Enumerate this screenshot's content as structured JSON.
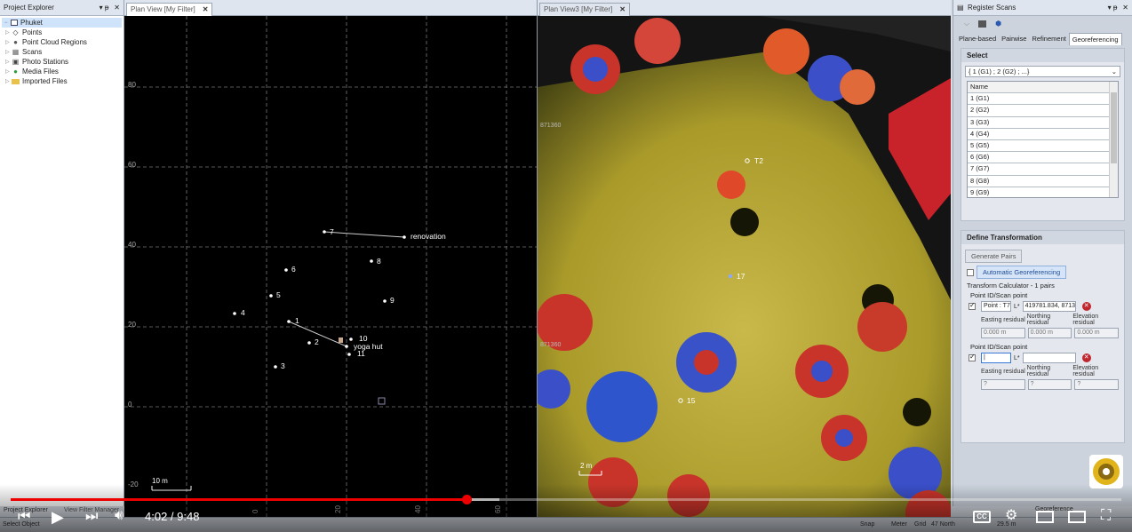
{
  "project_explorer": {
    "title": "Project Explorer",
    "ctl_pin": "▾ ᵽ",
    "ctl_close": "✕",
    "items": [
      {
        "label": "Phuket"
      },
      {
        "label": "Points"
      },
      {
        "label": "Point Cloud Regions"
      },
      {
        "label": "Scans"
      },
      {
        "label": "Photo Stations"
      },
      {
        "label": "Media Files"
      },
      {
        "label": "Imported Files"
      }
    ]
  },
  "view1": {
    "tab_label": "Plan View [My Filter]",
    "y_ticks": [
      "80",
      "60",
      "40",
      "20",
      "0",
      "-20"
    ],
    "x_ticks": [
      "0",
      "20",
      "40",
      "60"
    ],
    "scale_label": "10 m",
    "points": [
      {
        "label": "7"
      },
      {
        "label": "renovation"
      },
      {
        "label": "6"
      },
      {
        "label": "8"
      },
      {
        "label": "5"
      },
      {
        "label": "9"
      },
      {
        "label": "4"
      },
      {
        "label": "1"
      },
      {
        "label": "2"
      },
      {
        "label": "10"
      },
      {
        "label": "yoga hut"
      },
      {
        "label": "11"
      },
      {
        "label": "3"
      }
    ]
  },
  "view2": {
    "tab_label": "Plan View3 [My Filter]",
    "point_labels": [
      "T2",
      "17",
      "15"
    ],
    "coord_labels": [
      "871360",
      "871360"
    ],
    "scale_label": "2 m"
  },
  "register_scans": {
    "title": "Register Scans",
    "ctl_pin": "▾ ᵽ",
    "ctl_close": "✕",
    "tabs": [
      "Plane-based",
      "Pairwise",
      "Refinement",
      "Georeferencing"
    ],
    "select_header": "Select",
    "combo_value": "{ 1 (G1) ; 2 (G2) ; ...}",
    "list_header": "Name",
    "list_items": [
      "1 (G1)",
      "2 (G2)",
      "3 (G3)",
      "4 (G4)",
      "5 (G5)",
      "6 (G6)",
      "7 (G7)",
      "8 (G8)",
      "9 (G9)"
    ],
    "define_header": "Define Transformation",
    "generate_pairs": "Generate Pairs",
    "auto_georef": "Automatic Georeferencing",
    "calc_label": "Transform Calculator - 1 pairs",
    "pair1": {
      "label": "Point ID/Scan point",
      "point_id": "Point : T7",
      "scan_point": "419781.834, 8713",
      "easting_label": "Easting residual",
      "northing_label": "Northing residual",
      "elevation_label": "Elevation residual",
      "easting": "0.000 m",
      "northing": "0.000 m",
      "elevation": "0.000 m"
    },
    "pair2": {
      "label": "Point ID/Scan point",
      "point_id": "|",
      "scan_point": "",
      "easting_label": "Easting residual",
      "northing_label": "Northing residual",
      "elevation_label": "Elevation residual",
      "easting": "?",
      "northing": "?",
      "elevation": "?"
    }
  },
  "status": {
    "left_tab1": "Project Explorer",
    "left_tab2": "View Filter Manager",
    "select_text": "Select Object",
    "snap": "Snap",
    "meter": "Meter",
    "grid": "Grid",
    "north": "47 North",
    "coord": "29.5 m",
    "register_btn": "Georeference"
  },
  "video": {
    "time": "4:02 / 9:48",
    "progress": 0.41,
    "buffered": 0.44,
    "cc": "CC"
  }
}
